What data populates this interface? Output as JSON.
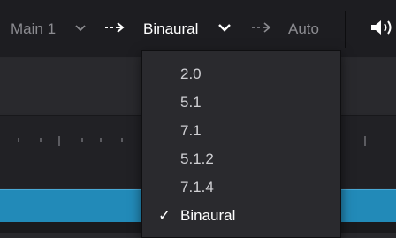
{
  "toolbar": {
    "main_label": "Main 1",
    "dropdown_chevron": "chevron-down-icon",
    "arrow_icon": "dashed-arrow-right-icon",
    "format_value": "Binaural",
    "auto_label": "Auto",
    "speaker_icon": "speaker-icon"
  },
  "menu": {
    "items": [
      "2.0",
      "5.1",
      "7.1",
      "5.1.2",
      "7.1.4",
      "Binaural"
    ],
    "selected": "Binaural",
    "check_glyph": "✓"
  },
  "colors": {
    "toolbar_bg": "#1d1d21",
    "menu_bg": "#2a2a2e",
    "track_blue": "#228ab8",
    "text_dim": "#8b8b90",
    "text_bright": "#ffffff"
  }
}
